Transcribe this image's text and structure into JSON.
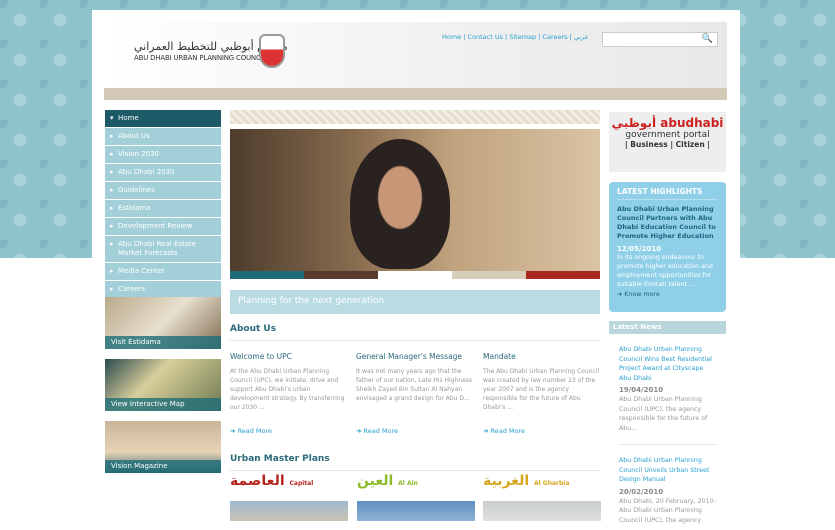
{
  "header": {
    "logo_arabic": "مجلس أبوظبي للتخطيط العمراني",
    "logo_english": "ABU DHABI URBAN PLANNING COUNCIL",
    "links": [
      "Home",
      "Contact Us",
      "Sitemap",
      "Careers",
      "عربي"
    ],
    "search_placeholder": ""
  },
  "nav": [
    "Home",
    "About Us",
    "Vision 2030",
    "Abu Dhabi 2030",
    "Guidelines",
    "Estidama",
    "Development Review",
    "Abu Dhabi Real Estate Market Forecasts",
    "Media Center",
    "Careers"
  ],
  "promos": [
    "Visit Estidama",
    "View Interactive Map",
    "Vision Magazine"
  ],
  "hero": {
    "colors": [
      "#1f6a78",
      "#5a3a2e",
      "#ffffff",
      "#d8cdb8",
      "#a8281e"
    ]
  },
  "banner": "Planning for the next generation",
  "about": {
    "title": "About Us",
    "columns": [
      {
        "title": "Welcome to UPC",
        "body": "At the Abu Dhabi Urban Planning Council (UPC), we initiate, drive and support Abu Dhabi's urban development strategy. By transferring our 2030 ...",
        "link": "Read More"
      },
      {
        "title": "General Manager's Message",
        "body": "It was not many years ago that the father of our nation, Late His Highness Sheikh Zayed Bin Sultan Al Nahyan envisaged a grand design for Abu D...",
        "link": "Read More"
      },
      {
        "title": "Mandate",
        "body": "The Abu Dhabi Urban Planning Council was created by law number 23 of the year 2007 and is the agency responsible for the future of Abu Dhabi's ...",
        "link": "Read More"
      }
    ]
  },
  "master_plans": {
    "title": "Urban Master Plans",
    "items": [
      {
        "arabic": "العاصمة",
        "english": "Capital",
        "color": "#b5261e"
      },
      {
        "arabic": "العين",
        "english": "Al Ain",
        "color": "#8dbb2a"
      },
      {
        "arabic": "الغربية",
        "english": "Al Gharbia",
        "color": "#d8a520"
      }
    ]
  },
  "gov_portal": {
    "arabic": "أبوظبي",
    "brand": "abudhabi",
    "subtitle": "government portal",
    "links": "| Business | Citizen |"
  },
  "highlights": {
    "heading": "LATEST HIGHLIGHTS",
    "title": "Abu Dhabi Urban Planning Council Partners with Abu Dhabi Education Council to Promote Higher Education",
    "date": "12/05/2010",
    "body": "In its ongoing endeavour to promote higher education and employment opportunities for suitable Emirati talent ....",
    "link": "Know more"
  },
  "latest_news": {
    "heading": "Latest News",
    "items": [
      {
        "title": "Abu Dhabi Urban Planning Council Wins Best Residential Project Award at Cityscape Abu Dhabi",
        "date": "19/04/2010",
        "body": "Abu Dhabi Urban Planning Council (UPC), the agency responsible for the future of Abu..."
      },
      {
        "title": "Abu Dhabi Urban Planning Council Unveils Urban Street Design Manual",
        "date": "20/02/2010",
        "body": "Abu Dhabi, 20 February, 2010: Abu Dhabi Urban Planning Council (UPC), the agency"
      }
    ]
  }
}
